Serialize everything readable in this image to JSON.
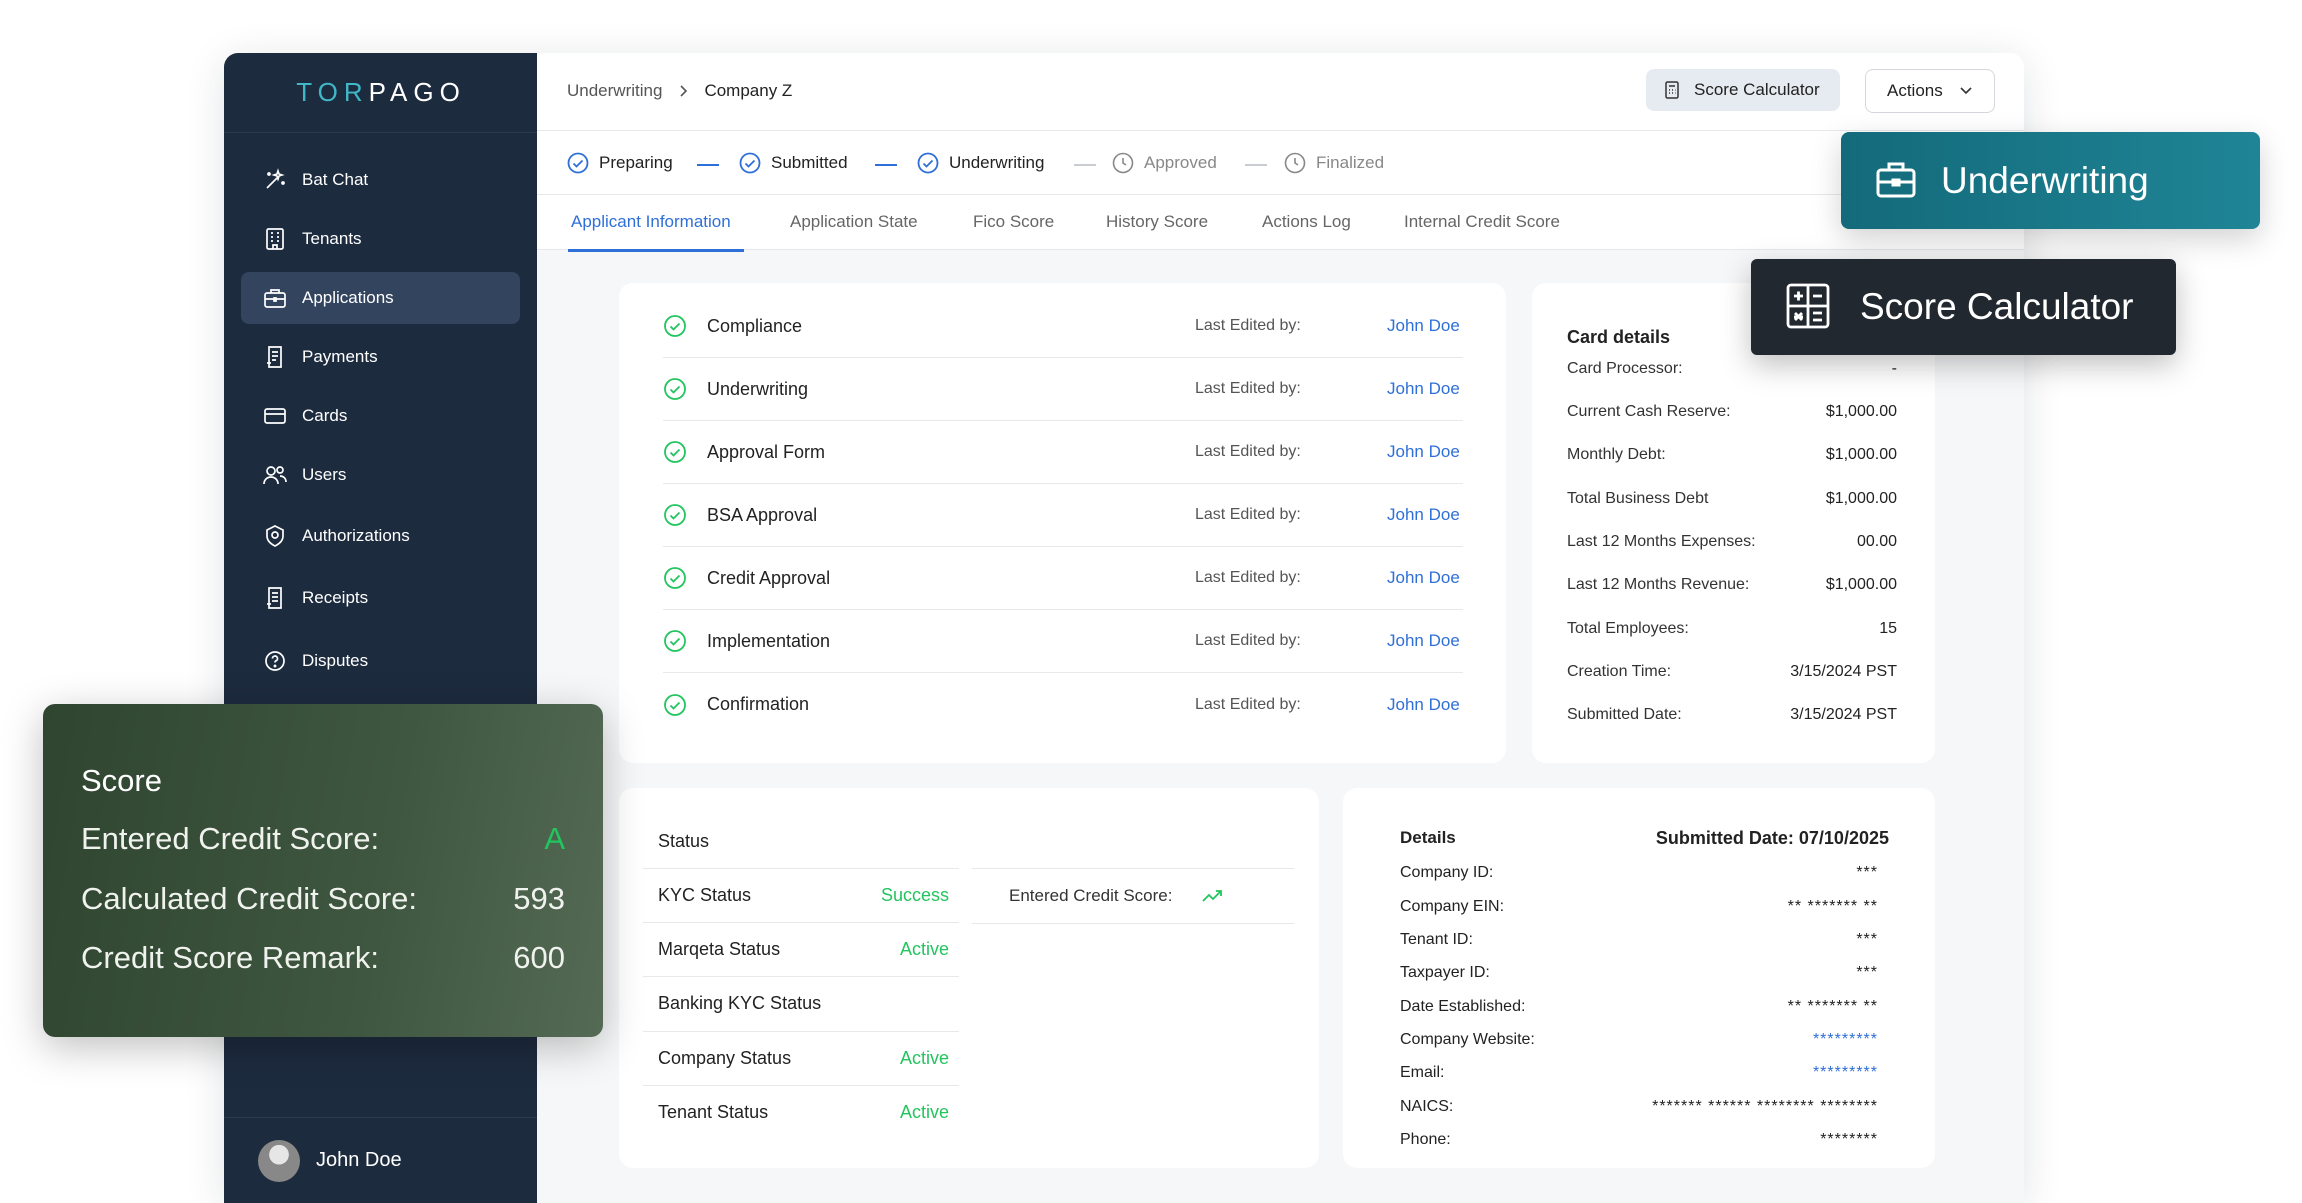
{
  "brand": {
    "logo_text": "TORPAGO"
  },
  "sidebar": {
    "items": [
      {
        "label": "Bat Chat",
        "icon": "sparkle-wand-icon",
        "active": false
      },
      {
        "label": "Tenants",
        "icon": "building-icon",
        "active": false
      },
      {
        "label": "Applications",
        "icon": "briefcase-icon",
        "active": true
      },
      {
        "label": "Payments",
        "icon": "receipt-icon",
        "active": false
      },
      {
        "label": "Cards",
        "icon": "credit-card-icon",
        "active": false
      },
      {
        "label": "Users",
        "icon": "users-icon",
        "active": false
      },
      {
        "label": "Authorizations",
        "icon": "shield-check-icon",
        "active": false
      },
      {
        "label": "Receipts",
        "icon": "document-icon",
        "active": false
      },
      {
        "label": "Disputes",
        "icon": "question-circle-icon",
        "active": false
      }
    ],
    "user": {
      "name": "John Doe"
    }
  },
  "header": {
    "breadcrumb": [
      "Underwriting",
      "Company Z"
    ],
    "score_calculator_label": "Score Calculator",
    "actions_label": "Actions"
  },
  "steps": [
    {
      "label": "Preparing",
      "status": "done"
    },
    {
      "label": "Submitted",
      "status": "done"
    },
    {
      "label": "Underwriting",
      "status": "done"
    },
    {
      "label": "Approved",
      "status": "pending"
    },
    {
      "label": "Finalized",
      "status": "pending"
    }
  ],
  "tabs": [
    {
      "label": "Applicant Information",
      "active": true
    },
    {
      "label": "Application State",
      "active": false
    },
    {
      "label": "Fico Score",
      "active": false
    },
    {
      "label": "History Score",
      "active": false
    },
    {
      "label": "Actions Log",
      "active": false
    },
    {
      "label": "Internal Credit Score",
      "active": false
    }
  ],
  "tasks": {
    "last_edited_label": "Last Edited by:",
    "items": [
      {
        "name": "Compliance",
        "editor": "John Doe"
      },
      {
        "name": "Underwriting",
        "editor": "John Doe"
      },
      {
        "name": "Approval Form",
        "editor": "John Doe"
      },
      {
        "name": "BSA Approval",
        "editor": "John Doe"
      },
      {
        "name": "Credit Approval",
        "editor": "John Doe"
      },
      {
        "name": "Implementation",
        "editor": "John Doe"
      },
      {
        "name": "Confirmation",
        "editor": "John Doe"
      }
    ]
  },
  "card_details": {
    "title": "Card details",
    "rows": [
      {
        "label": "Card Processor:",
        "value": "-"
      },
      {
        "label": "Current Cash Reserve:",
        "value": "$1,000.00"
      },
      {
        "label": "Monthly Debt:",
        "value": "$1,000.00"
      },
      {
        "label": "Total Business Debt",
        "value": "$1,000.00"
      },
      {
        "label": "Last 12 Months Expenses:",
        "value": "00.00"
      },
      {
        "label": "Last 12 Months Revenue:",
        "value": "$1,000.00"
      },
      {
        "label": "Total Employees:",
        "value": "15"
      },
      {
        "label": "Creation Time:",
        "value": "3/15/2024 PST"
      },
      {
        "label": "Submitted Date:",
        "value": "3/15/2024 PST"
      }
    ]
  },
  "status": {
    "title": "Status",
    "rows": [
      {
        "label": "KYC Status",
        "value": "Success"
      },
      {
        "label": "Marqeta Status",
        "value": "Active"
      },
      {
        "label": "Banking KYC Status",
        "value": ""
      },
      {
        "label": "Company Status",
        "value": "Active"
      },
      {
        "label": "Tenant Status",
        "value": "Active"
      }
    ],
    "entered_credit_score_label": "Entered Credit Score:"
  },
  "details": {
    "title": "Details",
    "submitted": "Submitted Date: 07/10/2025",
    "rows": [
      {
        "label": "Company ID:",
        "value": "***",
        "link": false
      },
      {
        "label": "Company EIN:",
        "value": "** ******* **",
        "link": false
      },
      {
        "label": "Tenant ID:",
        "value": "***",
        "link": false
      },
      {
        "label": "Taxpayer ID:",
        "value": "***",
        "link": false
      },
      {
        "label": "Date Established:",
        "value": "** ******* **",
        "link": false
      },
      {
        "label": "Company Website:",
        "value": "*********",
        "link": true
      },
      {
        "label": "Email:",
        "value": "*********",
        "link": true
      },
      {
        "label": "NAICS:",
        "value": "******* ****** ******** ********",
        "link": false
      },
      {
        "label": "Phone:",
        "value": "********",
        "link": false
      }
    ]
  },
  "overlays": {
    "underwriting": "Underwriting",
    "score_calculator": "Score Calculator",
    "score": {
      "title": "Score",
      "rows": [
        {
          "label": "Entered Credit Score:",
          "value": "A",
          "accent": "#22c55e"
        },
        {
          "label": "Calculated Credit Score:",
          "value": "593",
          "accent": "#ffffff"
        },
        {
          "label": "Credit Score Remark:",
          "value": "600",
          "accent": "#ffffff"
        }
      ]
    }
  },
  "colors": {
    "primary": "#2f6fd8",
    "success": "#22c55e",
    "sidebar": "#1d2b3f",
    "teal": "#136a7a"
  }
}
